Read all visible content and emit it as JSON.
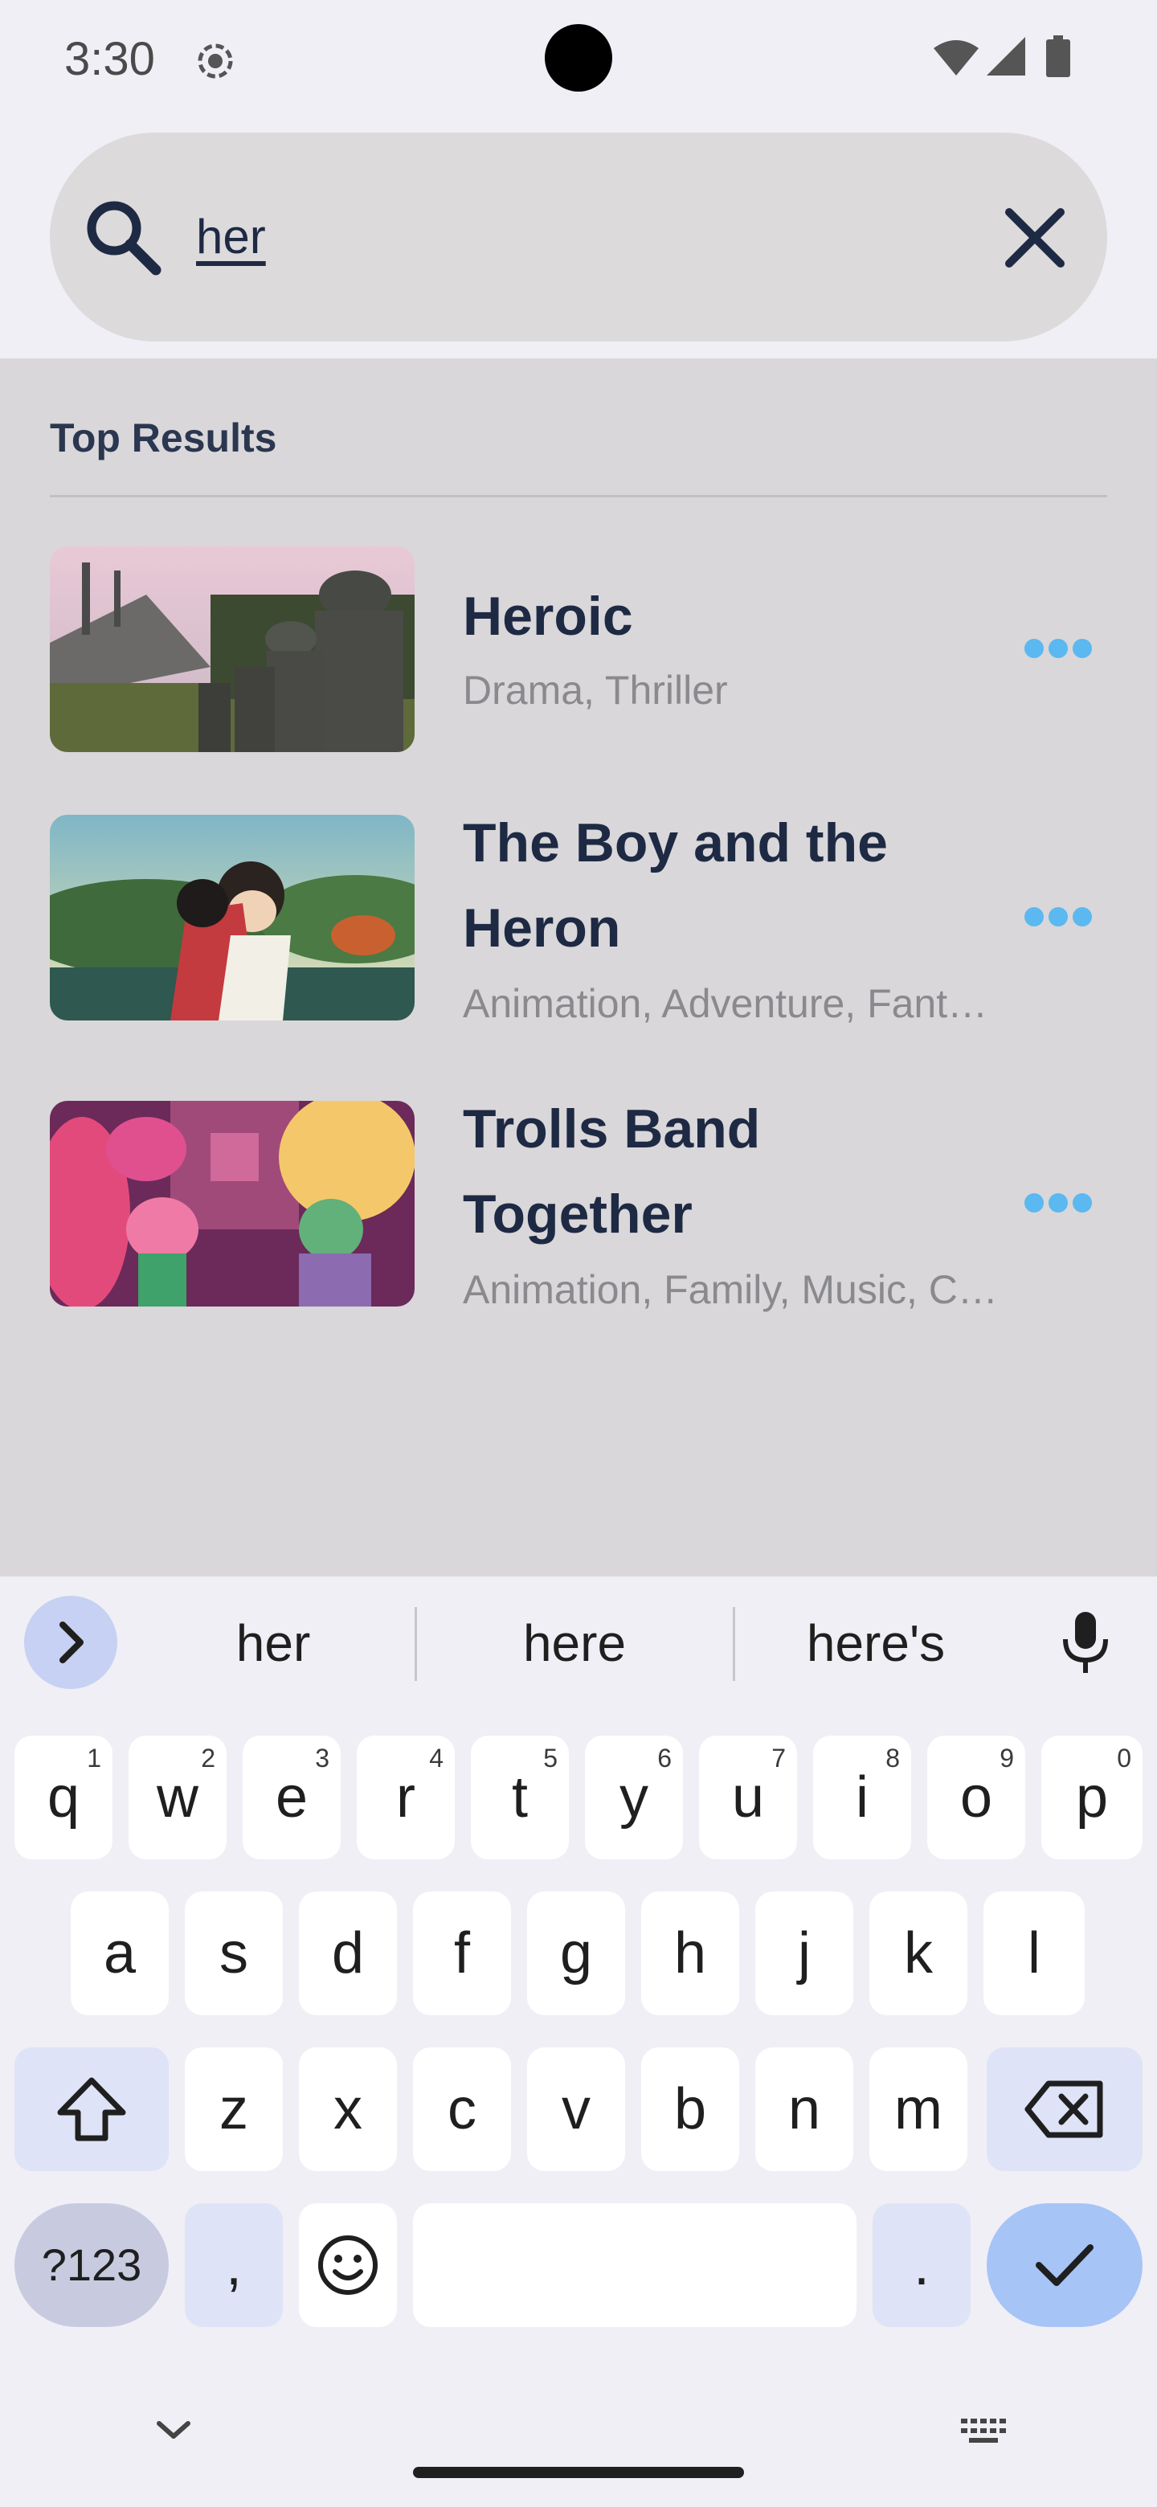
{
  "status_bar": {
    "time": "3:30"
  },
  "search": {
    "query": "her"
  },
  "results": {
    "heading": "Top Results",
    "items": [
      {
        "title": "Heroic",
        "genres": "Drama, Thriller"
      },
      {
        "title": "The Boy and the Heron",
        "genres": "Animation, Adventure, Fantasy"
      },
      {
        "title": "Trolls Band Together",
        "genres": "Animation, Family, Music, Comedy"
      }
    ]
  },
  "keyboard": {
    "suggestions": [
      "her",
      "here",
      "here's"
    ],
    "row1": [
      {
        "k": "q",
        "n": "1"
      },
      {
        "k": "w",
        "n": "2"
      },
      {
        "k": "e",
        "n": "3"
      },
      {
        "k": "r",
        "n": "4"
      },
      {
        "k": "t",
        "n": "5"
      },
      {
        "k": "y",
        "n": "6"
      },
      {
        "k": "u",
        "n": "7"
      },
      {
        "k": "i",
        "n": "8"
      },
      {
        "k": "o",
        "n": "9"
      },
      {
        "k": "p",
        "n": "0"
      }
    ],
    "row2": [
      "a",
      "s",
      "d",
      "f",
      "g",
      "h",
      "j",
      "k",
      "l"
    ],
    "row3": [
      "z",
      "x",
      "c",
      "v",
      "b",
      "n",
      "m"
    ],
    "symbols_label": "?123",
    "comma": ",",
    "period": "."
  },
  "colors": {
    "accent": "#5bb8f0",
    "text_primary": "#1e2a44",
    "panel_bg": "#d9d7d9",
    "enter_key": "#a7c4f7"
  },
  "icons": [
    "screen-record-icon",
    "wifi-icon",
    "signal-icon",
    "battery-icon",
    "search-icon",
    "close-icon",
    "more-horizontal-icon",
    "chevron-right-icon",
    "mic-icon",
    "shift-icon",
    "backspace-icon",
    "emoji-icon",
    "check-icon",
    "chevron-down-icon",
    "keyboard-icon"
  ]
}
